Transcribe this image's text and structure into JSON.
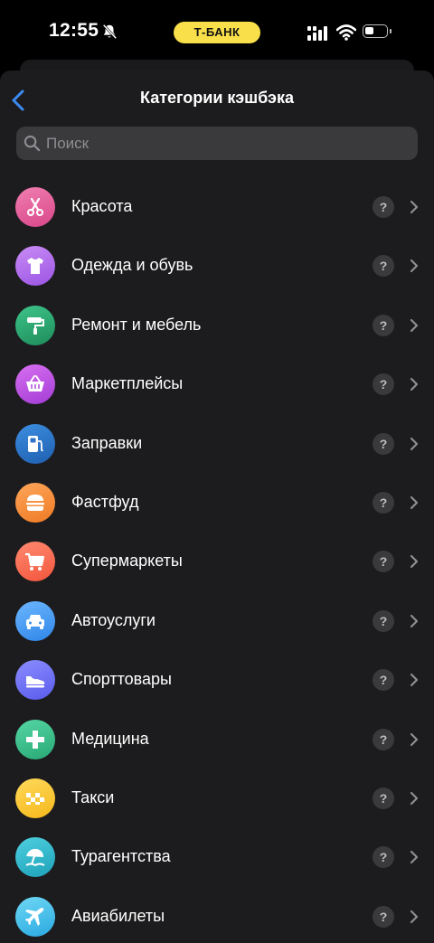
{
  "status_bar": {
    "time": "12:55",
    "carrier_pill": "Т-БАНК",
    "pill_color": "#f9e04a"
  },
  "header": {
    "title": "Категории кэшбэка"
  },
  "search": {
    "placeholder": "Поиск",
    "value": ""
  },
  "categories": [
    {
      "label": "Красота",
      "icon": "scissors-icon",
      "colors": [
        "#f07fb0",
        "#d9468a"
      ]
    },
    {
      "label": "Одежда и обувь",
      "icon": "tshirt-icon",
      "colors": [
        "#c98cf5",
        "#9b54e4"
      ]
    },
    {
      "label": "Ремонт и мебель",
      "icon": "paint-roller-icon",
      "colors": [
        "#3ec48a",
        "#1e8c5a"
      ]
    },
    {
      "label": "Маркетплейсы",
      "icon": "basket-icon",
      "colors": [
        "#d86ff0",
        "#a33cd6"
      ]
    },
    {
      "label": "Заправки",
      "icon": "fuel-pump-icon",
      "colors": [
        "#3d8ee0",
        "#1f5fb0"
      ]
    },
    {
      "label": "Фастфуд",
      "icon": "burger-icon",
      "colors": [
        "#ffa55a",
        "#ee7b25"
      ]
    },
    {
      "label": "Супермаркеты",
      "icon": "cart-icon",
      "colors": [
        "#ff8a70",
        "#f2553c"
      ]
    },
    {
      "label": "Автоуслуги",
      "icon": "car-icon",
      "colors": [
        "#6cb6ff",
        "#2f86e8"
      ]
    },
    {
      "label": "Спорттовары",
      "icon": "sneaker-icon",
      "colors": [
        "#8a8cff",
        "#5a5cec"
      ]
    },
    {
      "label": "Медицина",
      "icon": "medical-cross-icon",
      "colors": [
        "#55d6a4",
        "#28a874"
      ]
    },
    {
      "label": "Такси",
      "icon": "taxi-icon",
      "colors": [
        "#ffd95a",
        "#f5b81c"
      ]
    },
    {
      "label": "Турагентства",
      "icon": "beach-umbrella-icon",
      "colors": [
        "#4ed0e0",
        "#1ea1b8"
      ]
    },
    {
      "label": "Авиабилеты",
      "icon": "airplane-icon",
      "colors": [
        "#6fd8f5",
        "#2aa9e0"
      ]
    }
  ],
  "help_glyph": "?"
}
